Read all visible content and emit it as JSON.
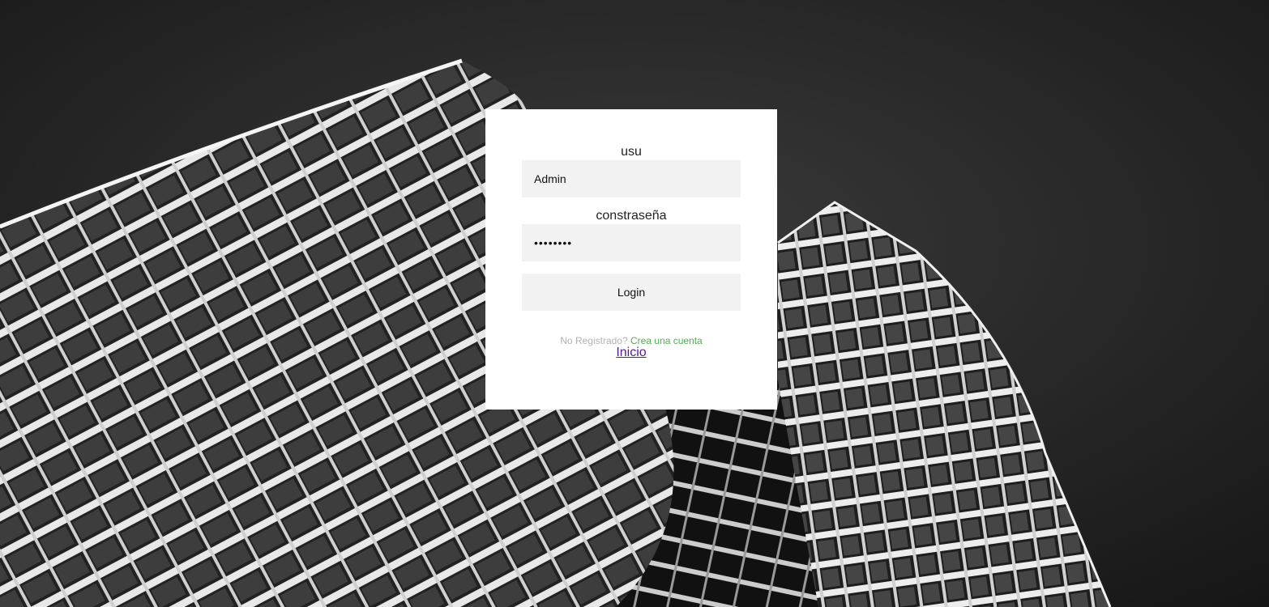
{
  "background": {
    "description_icon": "building-facade-image",
    "sky_color": "#2a2a2a"
  },
  "login": {
    "username_label": "usu",
    "username_value": "Admin",
    "password_label": "constraseña",
    "password_value": "••••••••",
    "login_button": "Login",
    "register_prompt": "No Registrado?",
    "register_link": "Crea una cuenta",
    "home_link": "Inicio"
  },
  "colors": {
    "card": "#ffffff",
    "input_bg": "#f2f2f2",
    "register_link": "#4CAF50",
    "register_prompt": "#b3b3b3",
    "home_link": "#551A8B"
  }
}
